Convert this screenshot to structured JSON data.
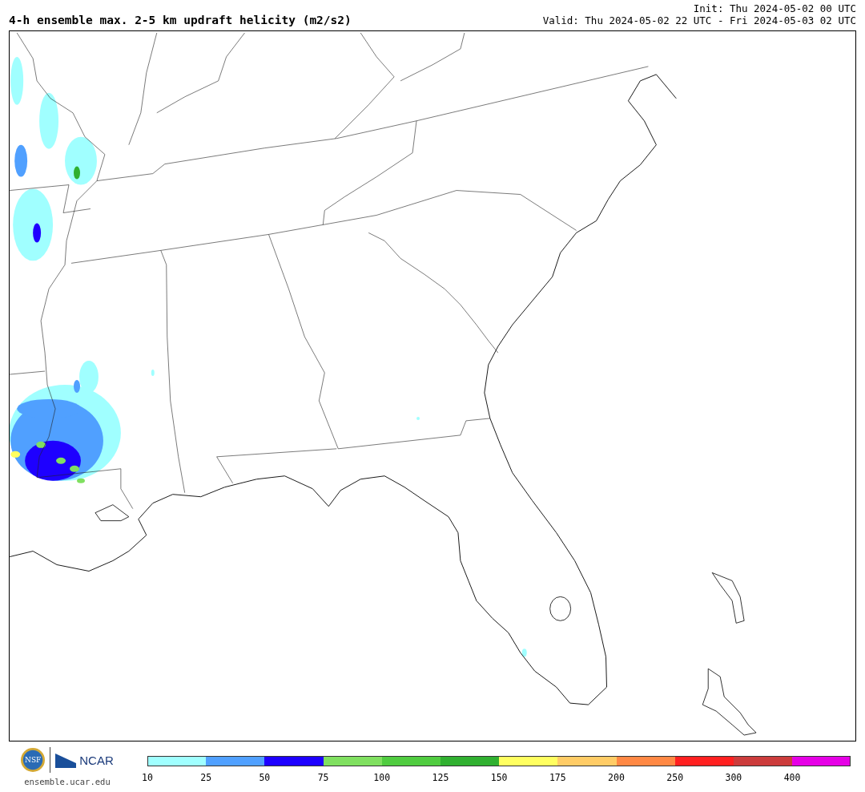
{
  "title": "4-h ensemble max. 2-5 km updraft helicity (m2/s2)",
  "init": "Init: Thu 2024-05-02 00 UTC",
  "valid": "Valid: Thu 2024-05-02 22 UTC - Fri 2024-05-03 02 UTC",
  "logos": {
    "nsf": "NSF",
    "ncar": "NCAR",
    "site": "ensemble.ucar.edu"
  },
  "colorbar": {
    "bins": [
      {
        "color": "#a0ffff",
        "label": "10"
      },
      {
        "color": "#50a0ff",
        "label": "25"
      },
      {
        "color": "#1e00ff",
        "label": "50"
      },
      {
        "color": "#80e060",
        "label": "75"
      },
      {
        "color": "#50cc40",
        "label": "100"
      },
      {
        "color": "#30b030",
        "label": "125"
      },
      {
        "color": "#ffff60",
        "label": "150"
      },
      {
        "color": "#ffcc66",
        "label": "175"
      },
      {
        "color": "#ff8844",
        "label": "200"
      },
      {
        "color": "#ff2020",
        "label": "250"
      },
      {
        "color": "#cc3c3c",
        "label": "300"
      },
      {
        "color": "#e600e6",
        "label": "400"
      }
    ]
  }
}
